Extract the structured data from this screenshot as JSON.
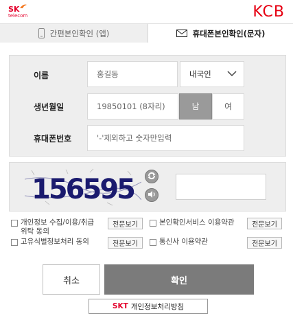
{
  "header": {
    "sk_logo_text": "SK",
    "sk_logo_sub": "telecom",
    "kcb_logo": "KCB"
  },
  "tabs": [
    {
      "label": "간편본인확인 (앱)",
      "icon": "phone-icon",
      "active": false
    },
    {
      "label": "휴대폰본인확인(문자)",
      "icon": "envelope-icon",
      "active": true
    }
  ],
  "form": {
    "name_label": "이름",
    "name_placeholder": "홍길동",
    "nationality_value": "내국인",
    "birth_label": "생년월일",
    "birth_placeholder": "19850101 (8자리)",
    "gender_male": "남",
    "gender_female": "여",
    "gender_selected": "남",
    "phone_label": "휴대폰번호",
    "phone_placeholder": "'-'제외하고 숫자만입력"
  },
  "captcha": {
    "text": "156595",
    "refresh_icon": "refresh-icon",
    "audio_icon": "speaker-icon"
  },
  "agreements": [
    {
      "label": "개인정보 수집/이용/취급 위탁 동의",
      "button": "전문보기"
    },
    {
      "label": "본인확인서비스 이용약관",
      "button": "전문보기"
    },
    {
      "label": "고유식별정보처리 동의",
      "button": "전문보기"
    },
    {
      "label": "통신사 이용약관",
      "button": "전문보기"
    }
  ],
  "actions": {
    "cancel_label": "취소",
    "confirm_label": "확인",
    "privacy_skt": "SKT",
    "privacy_text": "개인정보처리방침"
  },
  "colors": {
    "brand_red": "#e4002b",
    "kcb_red": "#e60012",
    "confirm_gray": "#7b7b7b",
    "selected_gender_bg": "#9a9a9a"
  }
}
